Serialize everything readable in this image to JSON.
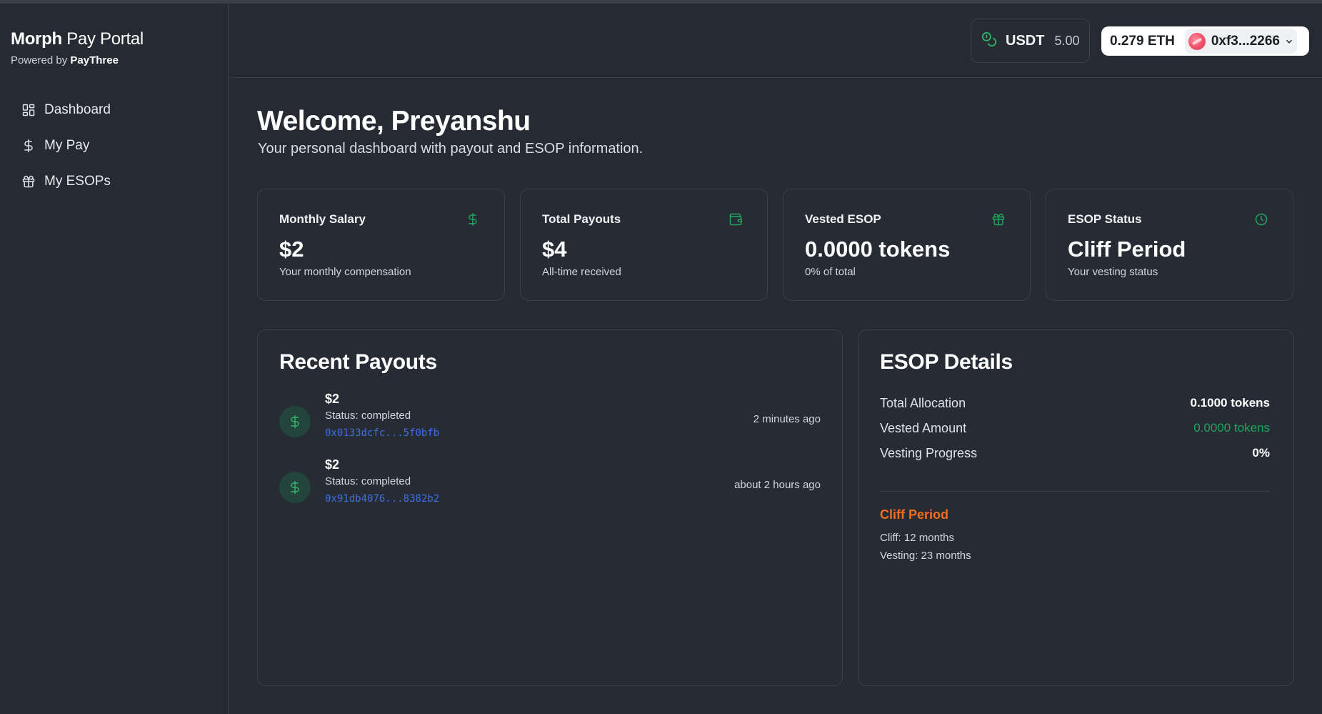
{
  "brand": {
    "name_bold": "Morph",
    "name_light": "Pay Portal",
    "powered_prefix": "Powered by",
    "powered_name": "PayThree"
  },
  "nav": [
    {
      "label": "Dashboard",
      "icon": "layout-grid-icon"
    },
    {
      "label": "My Pay",
      "icon": "dollar-icon"
    },
    {
      "label": "My ESOPs",
      "icon": "gift-icon"
    }
  ],
  "header": {
    "token": {
      "symbol": "USDT",
      "balance": "5.00",
      "icon": "coins-icon"
    },
    "account": {
      "balance": "0.279 ETH",
      "address": "0xf3...2266"
    }
  },
  "welcome": {
    "title": "Welcome, Preyanshu",
    "subtitle": "Your personal dashboard with payout and ESOP information."
  },
  "cards": [
    {
      "label": "Monthly Salary",
      "value": "$2",
      "note": "Your monthly compensation",
      "icon": "dollar-icon"
    },
    {
      "label": "Total Payouts",
      "value": "$4",
      "note": "All-time received",
      "icon": "wallet-icon"
    },
    {
      "label": "Vested ESOP",
      "value": "0.0000 tokens",
      "note": "0% of total",
      "icon": "gift-icon"
    },
    {
      "label": "ESOP Status",
      "value": "Cliff Period",
      "note": "Your vesting status",
      "icon": "clock-icon"
    }
  ],
  "recent_payouts": {
    "title": "Recent Payouts",
    "items": [
      {
        "amount": "$2",
        "status": "Status: completed",
        "tx": "0x0133dcfc...5f0bfb",
        "time": "2 minutes ago"
      },
      {
        "amount": "$2",
        "status": "Status: completed",
        "tx": "0x91db4076...8382b2",
        "time": "about 2 hours ago"
      }
    ]
  },
  "esop_details": {
    "title": "ESOP Details",
    "rows": [
      {
        "label": "Total Allocation",
        "value": "0.1000 tokens"
      },
      {
        "label": "Vested Amount",
        "value": "0.0000 tokens"
      },
      {
        "label": "Vesting Progress",
        "value": "0%"
      }
    ],
    "phase": "Cliff Period",
    "cliff": "Cliff: 12 months",
    "vesting": "Vesting: 23 months"
  },
  "colors": {
    "accent_green": "#22a35f",
    "warning_orange": "#f06f22",
    "link_blue": "#3e6fe3"
  }
}
